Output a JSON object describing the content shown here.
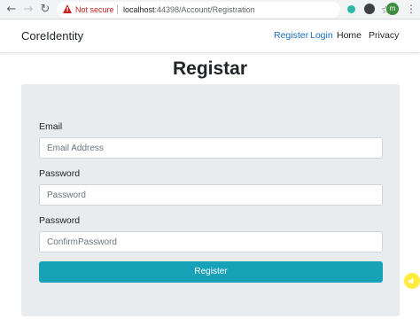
{
  "browser": {
    "back_icon": "arrow-left-icon",
    "forward_icon": "arrow-right-icon",
    "reload_icon": "reload-icon",
    "security_label": "Not secure",
    "url_host": "localhost",
    "url_rest": ":44398/Account/Registration",
    "avatar_letter": "m"
  },
  "navbar": {
    "brand": "CoreIdentity",
    "links": [
      "Register",
      "Login",
      "Home",
      "Privacy"
    ]
  },
  "page": {
    "title": "Registar"
  },
  "form": {
    "email_label": "Email",
    "email_placeholder": "Email Address",
    "password_label": "Password",
    "password_placeholder": "Password",
    "confirm_label": "Password",
    "confirm_placeholder": "ConfirmPassword",
    "submit_label": "Register"
  },
  "colors": {
    "link": "#1b6ec2",
    "button": "#17a2b8",
    "card": "#e9ecef",
    "warning": "#c5221f"
  }
}
